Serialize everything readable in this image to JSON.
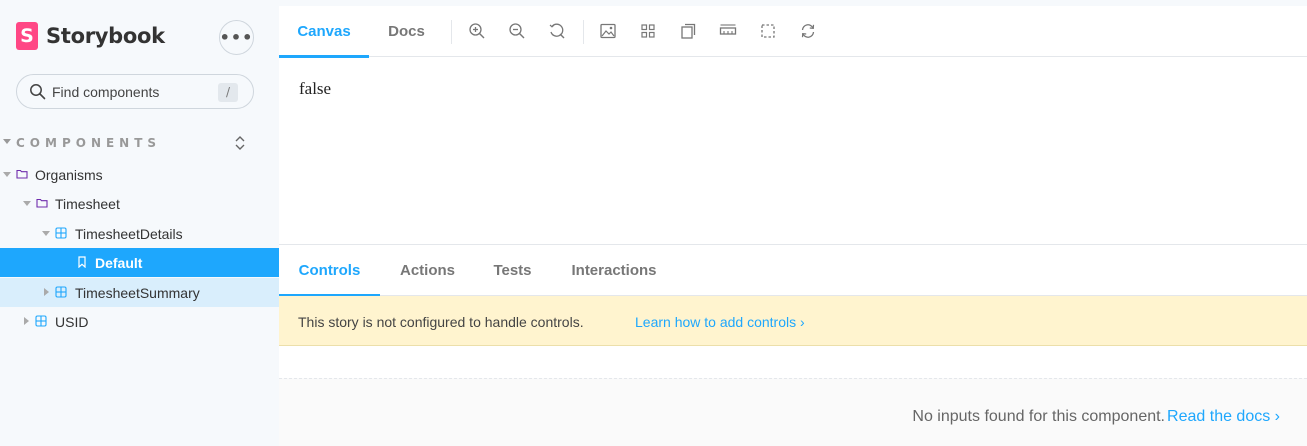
{
  "sidebar": {
    "brand": "Storybook",
    "logo_letter": "S",
    "menu_label": "•••",
    "search_placeholder": "Find components",
    "search_shortcut": "/",
    "section_title": "COMPONENTS",
    "tree": [
      {
        "label": "Organisms",
        "type": "folder",
        "state": "expanded"
      },
      {
        "label": "Timesheet",
        "type": "folder",
        "state": "expanded"
      },
      {
        "label": "TimesheetDetails",
        "type": "component",
        "state": "expanded"
      },
      {
        "label": "Default",
        "type": "story",
        "state": "selected"
      },
      {
        "label": "TimesheetSummary",
        "type": "component",
        "state": "collapsed"
      },
      {
        "label": "USID",
        "type": "component",
        "state": "collapsed"
      }
    ]
  },
  "toolbar": {
    "tabs": [
      {
        "label": "Canvas",
        "active": true
      },
      {
        "label": "Docs",
        "active": false
      }
    ],
    "icons": [
      "zoom-in-icon",
      "zoom-out-icon",
      "zoom-reset-icon",
      "background-icon",
      "grid-icon",
      "viewport-icon",
      "measure-icon",
      "outline-icon",
      "remount-icon"
    ]
  },
  "canvas": {
    "content": "false"
  },
  "addons": {
    "tabs": [
      {
        "label": "Controls",
        "active": true
      },
      {
        "label": "Actions",
        "active": false
      },
      {
        "label": "Tests",
        "active": false
      },
      {
        "label": "Interactions",
        "active": false
      }
    ],
    "notice_text": "This story is not configured to handle controls.",
    "notice_link": "Learn how to add controls ›",
    "empty_text": "No inputs found for this component.",
    "empty_link": "Read the docs ›"
  },
  "colors": {
    "accent": "#1ea7fd",
    "brand": "#ff4785",
    "notice_bg": "#fff4cf",
    "selected_bg": "#1ea7fd",
    "hover_bg": "#d9eefc"
  }
}
